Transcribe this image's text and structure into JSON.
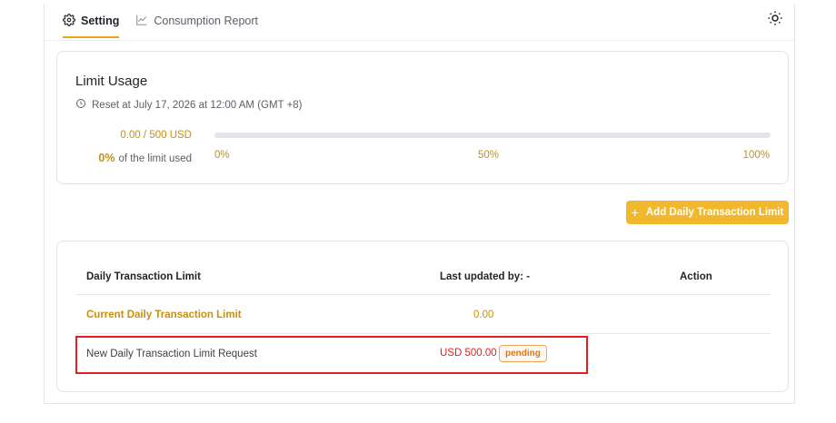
{
  "tabs": [
    {
      "label": "Setting",
      "icon": "gear-icon",
      "active": true
    },
    {
      "label": "Consumption Report",
      "icon": "chart-line-icon",
      "active": false
    }
  ],
  "theme_toggle_icon": "sun-icon",
  "usage": {
    "title": "Limit Usage",
    "reset_text": "Reset at July 17, 2026 at 12:00 AM (GMT +8)",
    "amount": "0.00 / 500 USD",
    "percent": "0%",
    "percent_caption": "of the limit used",
    "progress_fraction": 0,
    "ticks": [
      "0%",
      "50%",
      "100%"
    ]
  },
  "add_button": {
    "label": "Add Daily Transaction Limit"
  },
  "table": {
    "headers": {
      "limit": "Daily Transaction Limit",
      "updated": "Last updated by: -",
      "action": "Action"
    },
    "current": {
      "label": "Current Daily Transaction Limit",
      "value": "0.00"
    },
    "new_request": {
      "label": "New Daily Transaction Limit Request",
      "value": "USD 500.00",
      "status": "pending"
    }
  },
  "colors": {
    "accent": "#f1b82d",
    "accent_text": "#c8900e",
    "danger": "#e02020",
    "pending": "#e27512"
  }
}
